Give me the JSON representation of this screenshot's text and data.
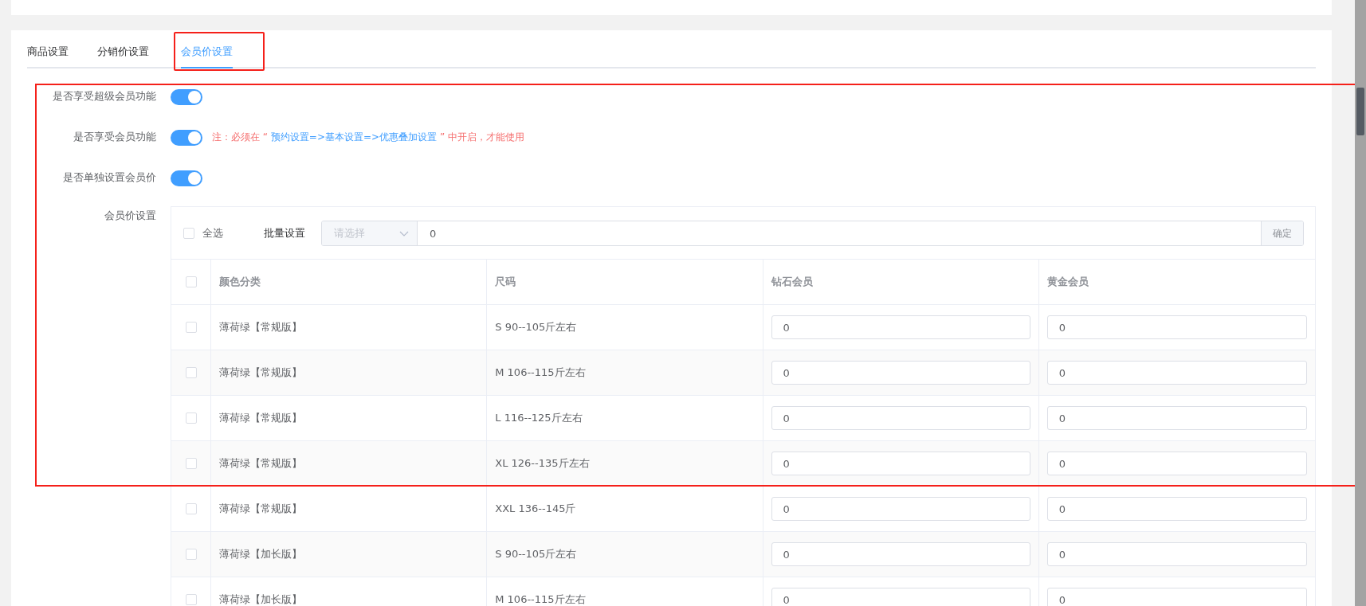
{
  "tabs": [
    {
      "label": "商品设置",
      "selected": false
    },
    {
      "label": "分销价设置",
      "selected": false
    },
    {
      "label": "会员价设置",
      "selected": true
    }
  ],
  "settings": [
    {
      "label": "是否享受超级会员功能",
      "on": true
    },
    {
      "label": "是否享受会员功能",
      "on": true,
      "note": {
        "prefix": "注：必须在 “ ",
        "link": "预约设置=>基本设置=>优惠叠加设置",
        "suffix": " ” 中开启，才能使用"
      }
    },
    {
      "label": "是否单独设置会员价",
      "on": true
    }
  ],
  "member_price": {
    "label": "会员价设置",
    "select_all": {
      "label": "全选",
      "checked": false
    },
    "batch": {
      "label": "批量设置",
      "select_placeholder": "请选择",
      "value": "0",
      "confirm": "确定"
    },
    "header_checked": false,
    "columns": [
      "颜色分类",
      "尺码",
      "钻石会员",
      "黄金会员"
    ],
    "rows": [
      {
        "checked": false,
        "color_class": "薄荷绿【常规版】",
        "size": "S 90--105斤左右",
        "diamond": "0",
        "gold": "0"
      },
      {
        "checked": false,
        "color_class": "薄荷绿【常规版】",
        "size": "M 106--115斤左右",
        "diamond": "0",
        "gold": "0"
      },
      {
        "checked": false,
        "color_class": "薄荷绿【常规版】",
        "size": "L 116--125斤左右",
        "diamond": "0",
        "gold": "0"
      },
      {
        "checked": false,
        "color_class": "薄荷绿【常规版】",
        "size": "XL 126--135斤左右",
        "diamond": "0",
        "gold": "0"
      },
      {
        "checked": false,
        "color_class": "薄荷绿【常规版】",
        "size": "XXL 136--145斤",
        "diamond": "0",
        "gold": "0"
      },
      {
        "checked": false,
        "color_class": "薄荷绿【加长版】",
        "size": "S 90--105斤左右",
        "diamond": "0",
        "gold": "0"
      },
      {
        "checked": false,
        "color_class": "薄荷绿【加长版】",
        "size": "M 106--115斤左右",
        "diamond": "0",
        "gold": "0"
      }
    ]
  }
}
